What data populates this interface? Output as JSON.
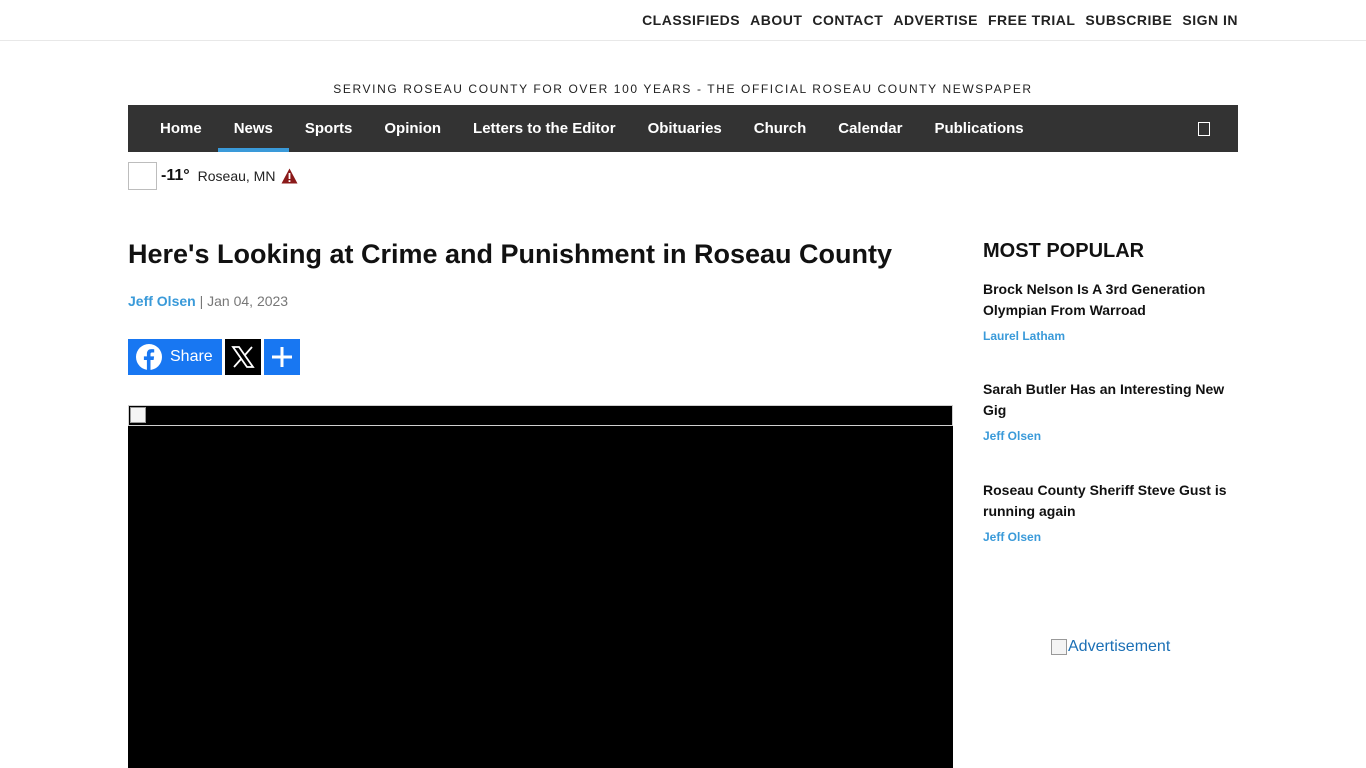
{
  "topnav": [
    "CLASSIFIEDS",
    "ABOUT",
    "CONTACT",
    "ADVERTISE",
    "FREE TRIAL",
    "SUBSCRIBE",
    "SIGN IN"
  ],
  "tagline": "SERVING ROSEAU COUNTY FOR OVER 100 YEARS - THE OFFICIAL ROSEAU COUNTY NEWSPAPER",
  "mainnav": {
    "items": [
      "Home",
      "News",
      "Sports",
      "Opinion",
      "Letters to the Editor",
      "Obituaries",
      "Church",
      "Calendar",
      "Publications"
    ],
    "active": "News"
  },
  "weather": {
    "temp": "-11°",
    "location": "Roseau, MN"
  },
  "article": {
    "headline": "Here's Looking at Crime and Punishment in Roseau County",
    "author": "Jeff Olsen",
    "separator": "|",
    "date": "Jan 04, 2023",
    "share_label": "Share"
  },
  "sidebar": {
    "title": "MOST POPULAR",
    "items": [
      {
        "title": "Brock Nelson Is A 3rd Generation Olympian From Warroad",
        "author": "Laurel Latham"
      },
      {
        "title": "Sarah Butler Has an Interesting New Gig",
        "author": "Jeff Olsen"
      },
      {
        "title": "Roseau County Sheriff Steve Gust is running again",
        "author": "Jeff Olsen"
      }
    ],
    "ad_alt": "Advertisement"
  },
  "colors": {
    "nav_bg": "#333333",
    "accent": "#3a9ad9",
    "facebook": "#1877f2"
  }
}
